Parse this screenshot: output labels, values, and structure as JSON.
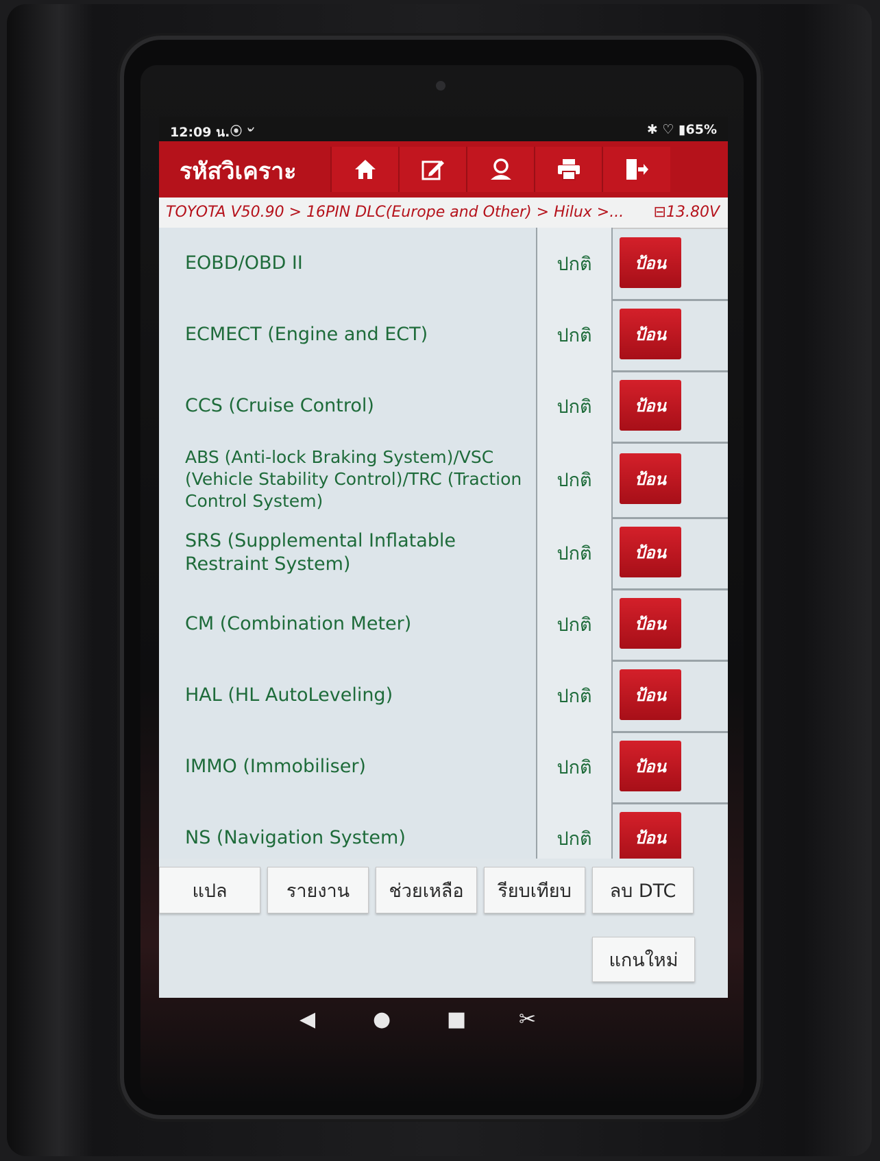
{
  "status_bar": {
    "time": "12:09 น.",
    "icons_left": "⦿ ৺",
    "icons_right": "✱ ♡ ▮65%"
  },
  "toolbar": {
    "title": "รหัสวิเคราะ",
    "buttons": [
      {
        "icon": "home-icon"
      },
      {
        "icon": "edit-icon"
      },
      {
        "icon": "user-icon"
      },
      {
        "icon": "print-icon"
      },
      {
        "icon": "exit-icon"
      }
    ]
  },
  "breadcrumb": {
    "path": "TOYOTA V50.90 > 16PIN DLC(Europe and Other) > Hilux >...",
    "voltage": "13.80V"
  },
  "systems": [
    {
      "name": "EOBD/OBD II",
      "status": "ปกติ",
      "action": "ป้อน"
    },
    {
      "name": "ECMECT (Engine and ECT)",
      "status": "ปกติ",
      "action": "ป้อน"
    },
    {
      "name": "CCS (Cruise Control)",
      "status": "ปกติ",
      "action": "ป้อน"
    },
    {
      "name": "ABS (Anti-lock Braking System)/VSC (Vehicle Stability Control)/TRC (Traction Control System)",
      "status": "ปกติ",
      "action": "ป้อน"
    },
    {
      "name": "SRS (Supplemental Inflatable Restraint System)",
      "status": "ปกติ",
      "action": "ป้อน"
    },
    {
      "name": "CM (Combination Meter)",
      "status": "ปกติ",
      "action": "ป้อน"
    },
    {
      "name": "HAL (HL AutoLeveling)",
      "status": "ปกติ",
      "action": "ป้อน"
    },
    {
      "name": "IMMO (Immobiliser)",
      "status": "ปกติ",
      "action": "ป้อน"
    },
    {
      "name": "NS (Navigation System)",
      "status": "ปกติ",
      "action": "ป้อน"
    }
  ],
  "bottom_buttons": [
    "แปล",
    "รายงาน",
    "ช่วยเหลือ",
    "รียบเทียบ",
    "ลบ DTC"
  ],
  "rescan_button": "แกนใหม่",
  "nav_icons": [
    "back-icon",
    "home-circle-icon",
    "recents-icon",
    "screenshot-icon"
  ],
  "colors": {
    "accent": "#b5121b",
    "text_green": "#1e6b3a"
  }
}
